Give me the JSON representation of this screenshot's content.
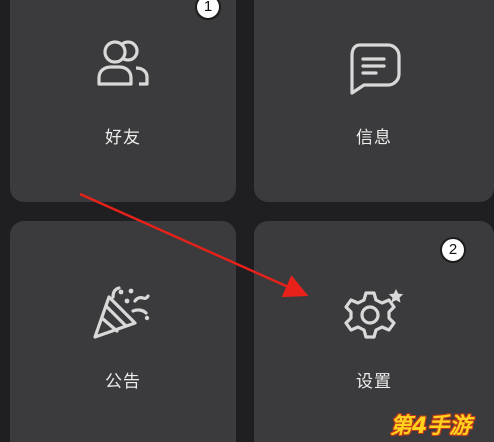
{
  "grid": {
    "tiles": [
      {
        "key": "friends",
        "label": "好友",
        "icon": "users-icon"
      },
      {
        "key": "messages",
        "label": "信息",
        "icon": "message-icon"
      },
      {
        "key": "notices",
        "label": "公告",
        "icon": "party-popper-icon"
      },
      {
        "key": "settings",
        "label": "设置",
        "icon": "gear-icon"
      }
    ]
  },
  "annotations": {
    "step_1": "1",
    "step_2": "2",
    "arrow_color": "#e8211b"
  },
  "watermark": {
    "text": "第4手游"
  },
  "colors": {
    "background": "#1f1f21",
    "tile": "#3b3b3d",
    "icon": "#d9d9d9",
    "label": "#ededed"
  }
}
